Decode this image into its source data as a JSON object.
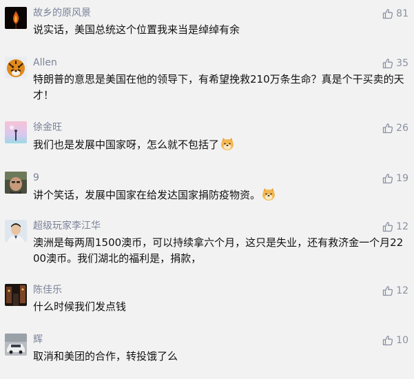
{
  "colors": {
    "background": "#f2f2f2",
    "username": "#7a8299",
    "like": "#8a90a0",
    "text": "#111111"
  },
  "icons": {
    "like": "thumbs-up-icon",
    "emoji": "doge-emoji-icon"
  },
  "comments": [
    {
      "username": "故乡的原风景",
      "likes": "81",
      "text": "说实话，美国总统这个位置我来当是绰绰有余"
    },
    {
      "username": "Allen",
      "likes": "35",
      "text": "特朗普的意思是美国在他的领导下，有希望挽救210万条生命？真是个干买卖的天才！"
    },
    {
      "username": "徐金旺",
      "likes": "26",
      "text": "我们也是发展中国家呀，怎么就不包括了"
    },
    {
      "username": "9",
      "likes": "19",
      "text": "讲个笑话，发展中国家在给发达国家捐防疫物资。"
    },
    {
      "username": "超级玩家李江华",
      "likes": "12",
      "text": "澳洲是每两周1500澳币，可以持续拿六个月，这只是失业，还有救济金一个月2200澳币。我们湖北的福利是，捐款，"
    },
    {
      "username": "陈佳乐",
      "likes": "12",
      "text": "什么时候我们发点钱"
    },
    {
      "username": "辉",
      "likes": "10",
      "text": "取消和美团的合作，转投饿了么"
    }
  ]
}
